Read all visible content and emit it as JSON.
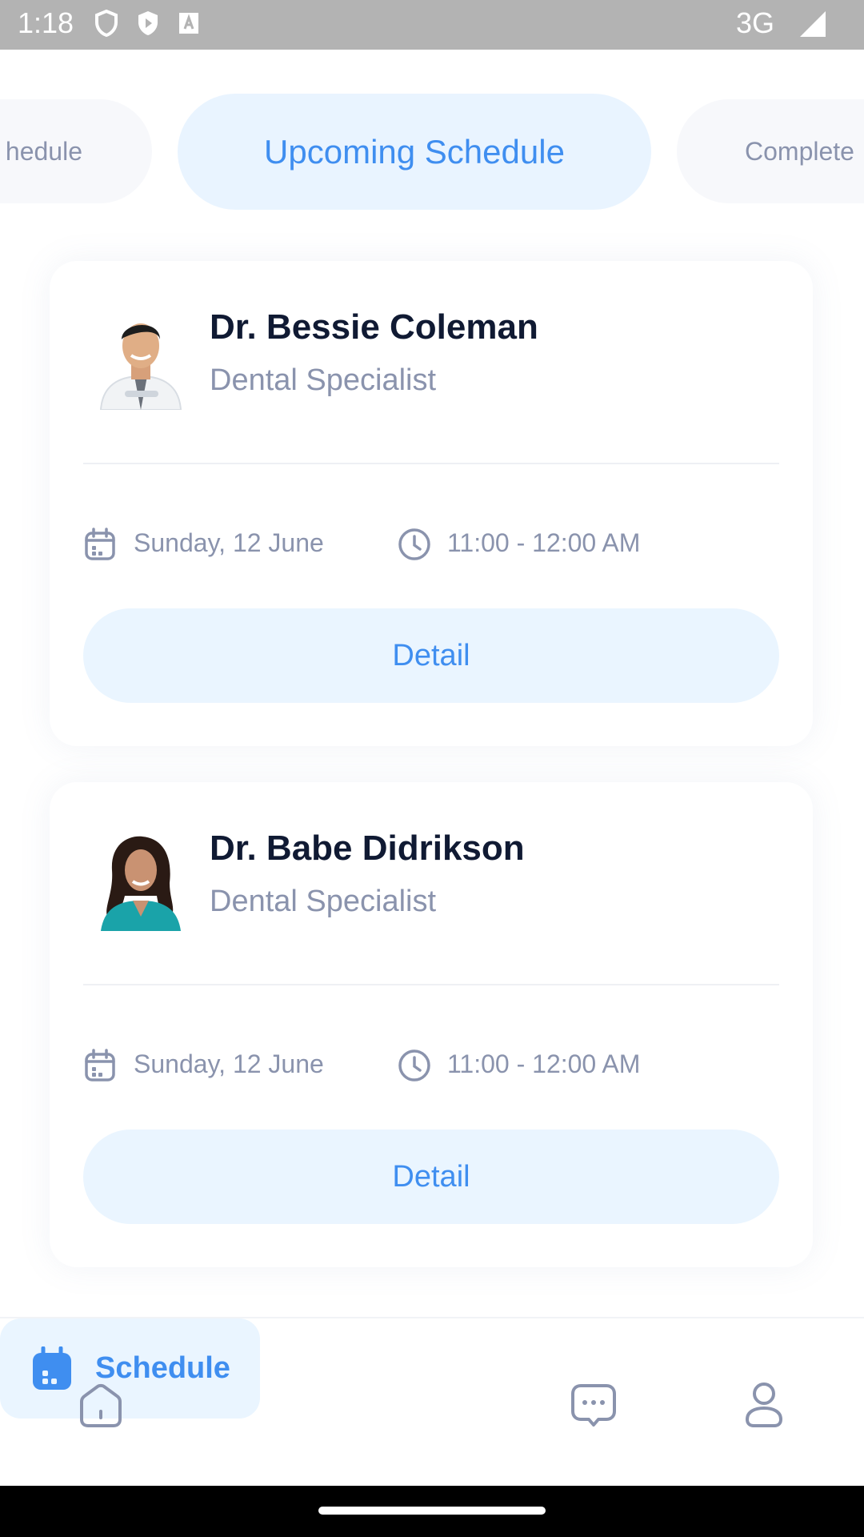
{
  "status_bar": {
    "time": "1:18",
    "network": "3G"
  },
  "tabs": [
    {
      "label": "Schedule",
      "visible_text": "hedule"
    },
    {
      "label": "Upcoming Schedule",
      "visible_text": "Upcoming Schedule",
      "active": true
    },
    {
      "label": "Completed",
      "visible_text": "Complete"
    }
  ],
  "appointments": [
    {
      "doctor_name": "Dr. Bessie Coleman",
      "specialty": "Dental Specialist",
      "date": "Sunday, 12 June",
      "time": "11:00 - 12:00 AM",
      "button_label": "Detail"
    },
    {
      "doctor_name": "Dr. Babe Didrikson",
      "specialty": "Dental Specialist",
      "date": "Sunday, 12 June",
      "time": "11:00 - 12:00 AM",
      "button_label": "Detail"
    }
  ],
  "bottom_nav": {
    "items": [
      {
        "icon": "home-icon",
        "label": ""
      },
      {
        "icon": "calendar-icon",
        "label": "Schedule",
        "active": true
      },
      {
        "icon": "chat-icon",
        "label": ""
      },
      {
        "icon": "profile-icon",
        "label": ""
      }
    ]
  },
  "colors": {
    "accent": "#3f8ef0",
    "accent_bg": "#eaf5ff",
    "muted_text": "#8a93ad",
    "title_text": "#101a33"
  }
}
